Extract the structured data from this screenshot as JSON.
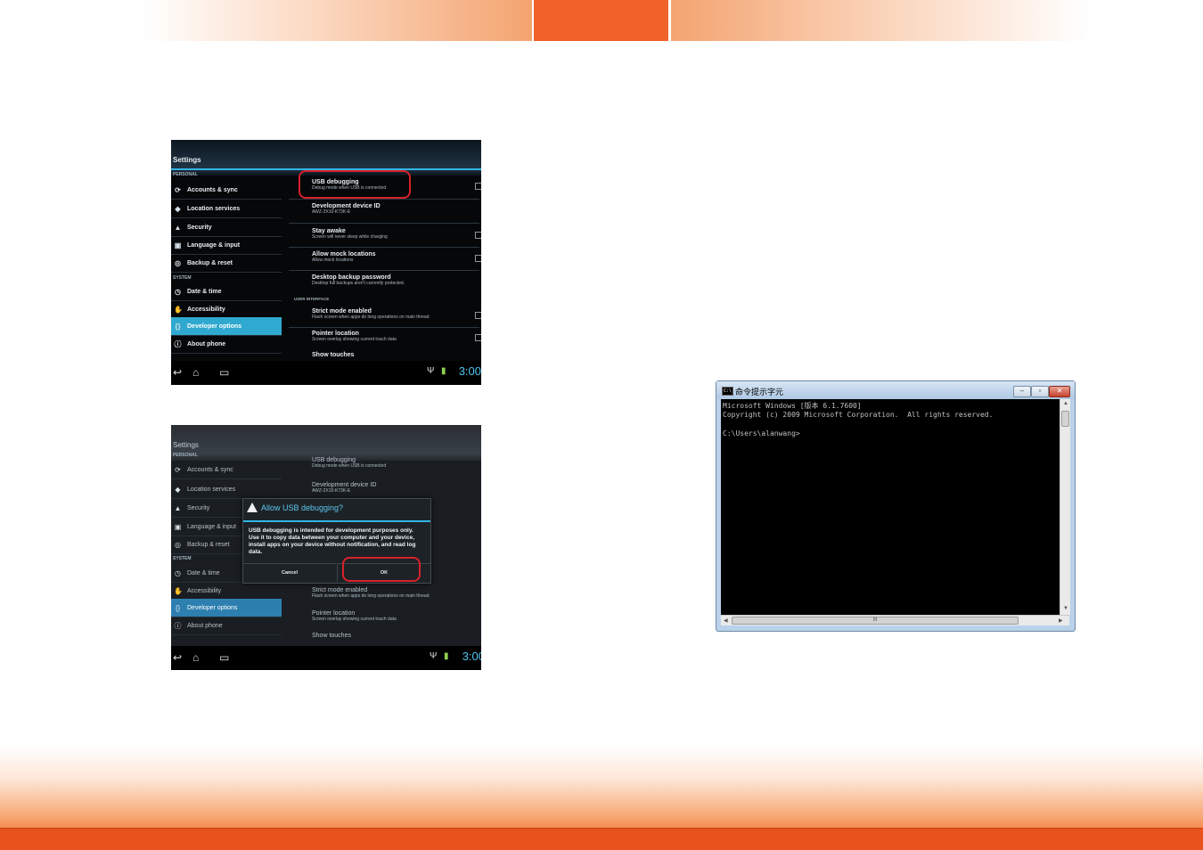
{
  "screenshot1": {
    "settings_title": "Settings",
    "sections": {
      "personal": "PERSONAL",
      "system": "SYSTEM",
      "user_interface": "USER INTERFACE"
    },
    "sidebar": [
      {
        "label": "Accounts & sync",
        "icon": "sync-icon"
      },
      {
        "label": "Location services",
        "icon": "location-icon"
      },
      {
        "label": "Security",
        "icon": "lock-icon"
      },
      {
        "label": "Language & input",
        "icon": "keyboard-icon"
      },
      {
        "label": "Backup & reset",
        "icon": "backup-icon"
      },
      {
        "label": "Date & time",
        "icon": "clock-icon"
      },
      {
        "label": "Accessibility",
        "icon": "hand-icon"
      },
      {
        "label": "Developer options",
        "icon": "braces-icon",
        "selected": true
      },
      {
        "label": "About phone",
        "icon": "info-icon"
      }
    ],
    "options": [
      {
        "title": "USB debugging",
        "sub": "Debug mode when USB is connected"
      },
      {
        "title": "Development device ID",
        "sub": "AWZ-2X10-K73K-E"
      },
      {
        "title": "Stay awake",
        "sub": "Screen will never sleep while charging"
      },
      {
        "title": "Allow mock locations",
        "sub": "Allow mock locations"
      },
      {
        "title": "Desktop backup password",
        "sub": "Desktop full backups aren't currently protected."
      },
      {
        "title": "Strict mode enabled",
        "sub": "Flash screen when apps do long operations on main thread"
      },
      {
        "title": "Pointer location",
        "sub": "Screen overlay showing current touch data"
      },
      {
        "title": "Show touches",
        "sub": ""
      }
    ],
    "clock": "3:00"
  },
  "screenshot2": {
    "settings_title": "Settings",
    "dialog": {
      "title": "Allow USB debugging?",
      "body": "USB debugging is intended for development purposes only. Use it to copy data between your computer and your device, install apps on your device without notification, and read log data.",
      "cancel": "Cancel",
      "ok": "OK"
    },
    "clock": "3:00"
  },
  "cmd": {
    "title": "命令提示字元",
    "line1": "Microsoft Windows [版本 6.1.7600]",
    "line2": "Copyright (c) 2009 Microsoft Corporation.  All rights reserved.",
    "line3": "C:\\Users\\alanwang>",
    "scroll_grip": "III"
  },
  "colors": {
    "accent": "#f0622a",
    "footer_bar": "#e8521d",
    "android_blue": "#33b5e5",
    "highlight_red": "#d8212b"
  }
}
